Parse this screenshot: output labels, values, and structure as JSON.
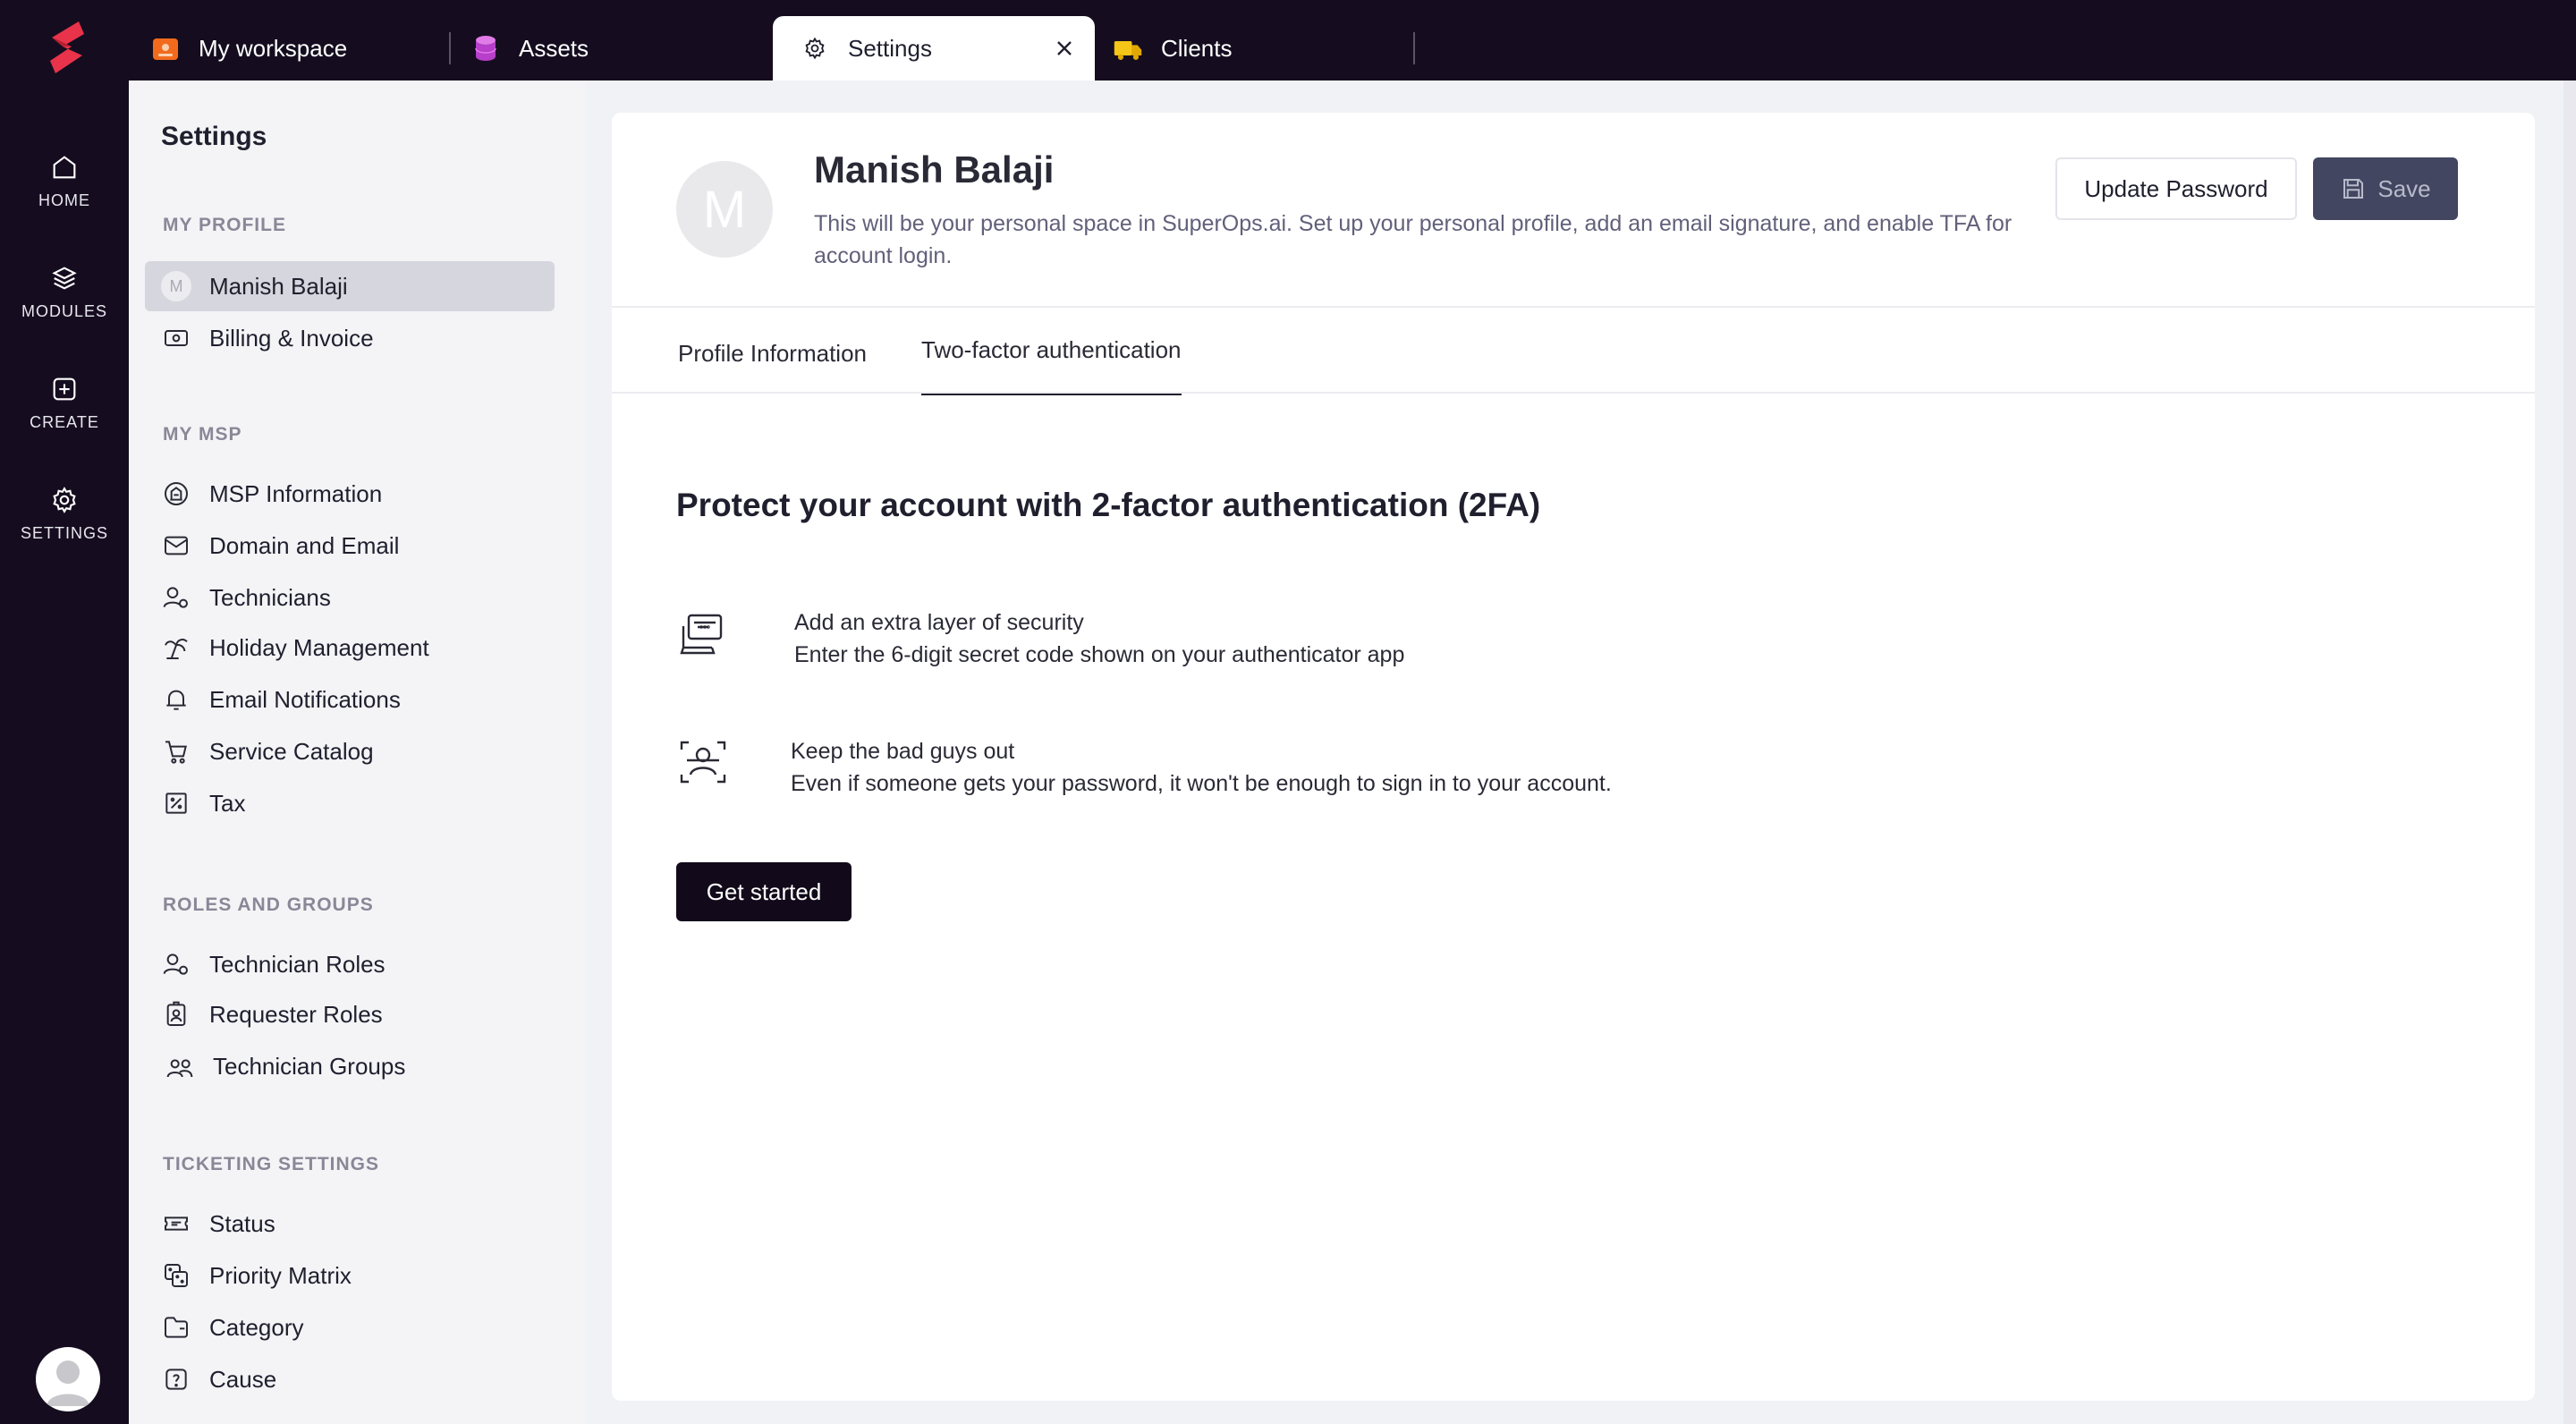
{
  "rail": {
    "items": [
      {
        "label": "HOME",
        "icon": "home-icon"
      },
      {
        "label": "MODULES",
        "icon": "layers-icon"
      },
      {
        "label": "CREATE",
        "icon": "plus-square-icon"
      },
      {
        "label": "SETTINGS",
        "icon": "gear-icon"
      }
    ]
  },
  "tabs": [
    {
      "label": "My workspace",
      "icon": "workspace-icon",
      "color": "#f26b1d"
    },
    {
      "label": "Assets",
      "icon": "database-icon",
      "color": "#c94fd8"
    },
    {
      "label": "Settings",
      "icon": "gear-icon",
      "active": true
    },
    {
      "label": "Clients",
      "icon": "truck-icon",
      "color": "#f5c518"
    }
  ],
  "sidebar": {
    "title": "Settings",
    "sections": [
      {
        "heading": "MY PROFILE",
        "items": [
          {
            "label": "Manish Balaji",
            "initial": "M",
            "selected": true
          },
          {
            "label": "Billing & Invoice",
            "icon": "billing-icon"
          }
        ]
      },
      {
        "heading": "MY MSP",
        "items": [
          {
            "label": "MSP Information",
            "icon": "building-icon"
          },
          {
            "label": "Domain and Email",
            "icon": "mail-icon"
          },
          {
            "label": "Technicians",
            "icon": "technician-icon"
          },
          {
            "label": "Holiday Management",
            "icon": "palm-icon"
          },
          {
            "label": "Email Notifications",
            "icon": "bell-icon"
          },
          {
            "label": "Service Catalog",
            "icon": "cart-icon"
          },
          {
            "label": "Tax",
            "icon": "percent-icon"
          }
        ]
      },
      {
        "heading": "ROLES AND GROUPS",
        "items": [
          {
            "label": "Technician Roles",
            "icon": "technician-role-icon"
          },
          {
            "label": "Requester Roles",
            "icon": "badge-icon"
          },
          {
            "label": "Technician Groups",
            "icon": "group-icon"
          }
        ]
      },
      {
        "heading": "TICKETING SETTINGS",
        "items": [
          {
            "label": "Status",
            "icon": "ticket-icon"
          },
          {
            "label": "Priority Matrix",
            "icon": "dice-icon"
          },
          {
            "label": "Category",
            "icon": "folder-icon"
          },
          {
            "label": "Cause",
            "icon": "question-icon"
          }
        ]
      }
    ]
  },
  "profile": {
    "initial": "M",
    "name": "Manish Balaji",
    "description": "This will be your personal space in SuperOps.ai. Set up your personal profile, add an email signature, and enable TFA for account login.",
    "update_password_label": "Update Password",
    "save_label": "Save"
  },
  "profile_tabs": [
    {
      "label": "Profile Information"
    },
    {
      "label": "Two-factor authentication",
      "active": true
    }
  ],
  "tfa": {
    "heading": "Protect your account with 2-factor authentication (2FA)",
    "features": [
      {
        "title": "Add an extra layer of security",
        "text": "Enter the 6-digit secret code shown on your authenticator app",
        "icon": "laptop-code-icon"
      },
      {
        "title": "Keep the bad guys out",
        "text": "Even if someone gets your password, it won't be enough to sign in to your account.",
        "icon": "face-scan-icon"
      }
    ],
    "cta_label": "Get started"
  }
}
